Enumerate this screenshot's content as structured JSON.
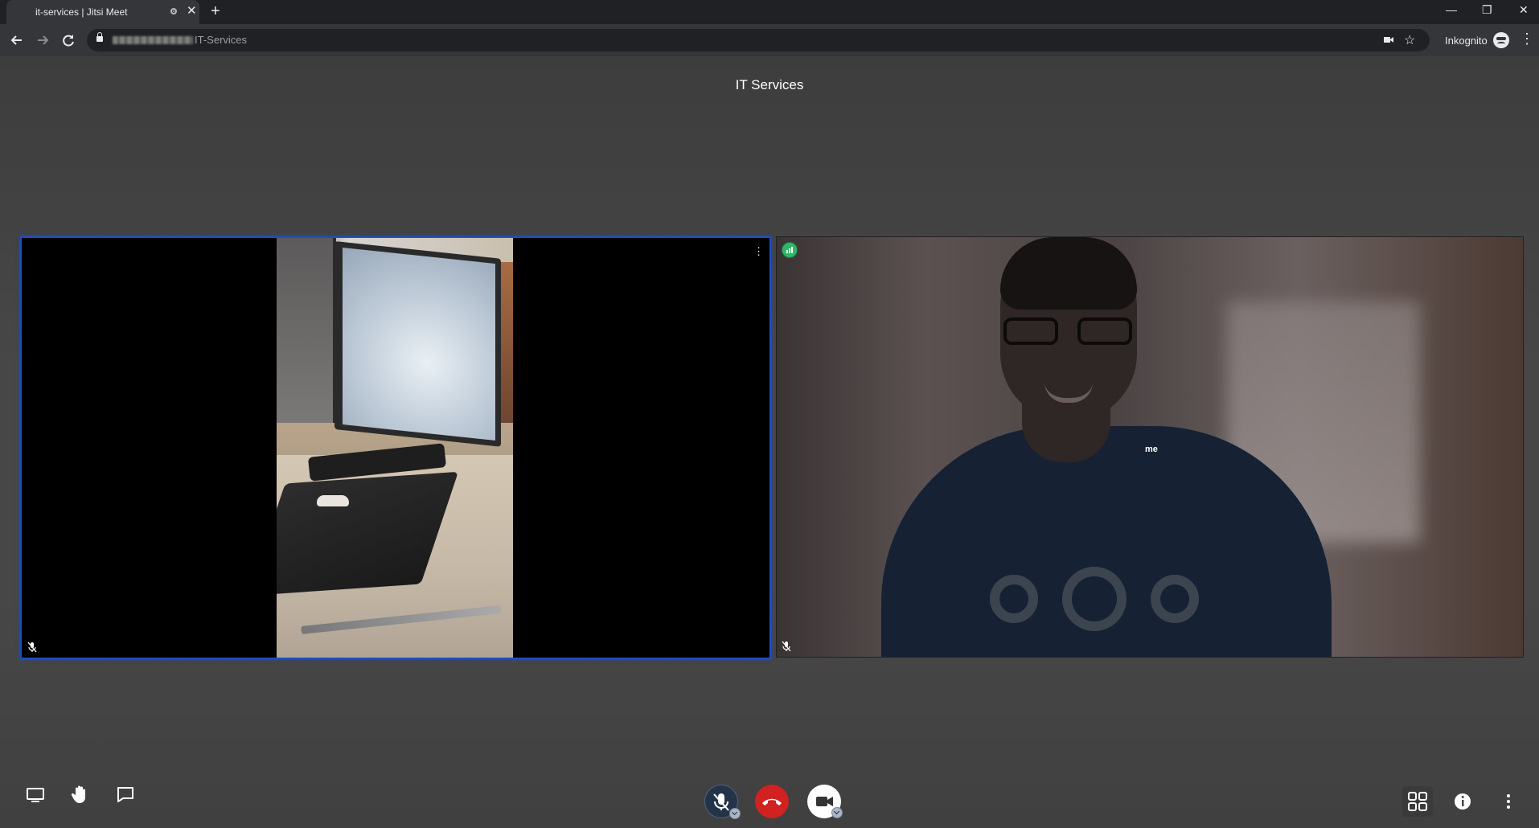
{
  "browser": {
    "tab_title": "it-services | Jitsi Meet",
    "tab_close": "✕",
    "new_tab": "+",
    "url_path": "IT-Services",
    "profile_label": "Inkognito",
    "window_controls": [
      "—",
      "❐",
      "✕"
    ]
  },
  "meeting": {
    "title": "IT Services",
    "participants": [
      {
        "name": "",
        "muted": true,
        "active_speaker": true
      },
      {
        "name": "me",
        "muted": true,
        "active_speaker": false
      }
    ]
  },
  "toolbar": {
    "left": [
      "screen-share-icon",
      "raise-hand-icon",
      "chat-icon"
    ],
    "center": [
      "microphone-muted-icon",
      "hangup-icon",
      "camera-icon"
    ],
    "right": [
      "tile-view-icon",
      "info-icon",
      "more-options-icon"
    ]
  },
  "colors": {
    "active_border": "#1e4fbf",
    "hangup": "#d12121",
    "connection_good": "#31b76a"
  }
}
